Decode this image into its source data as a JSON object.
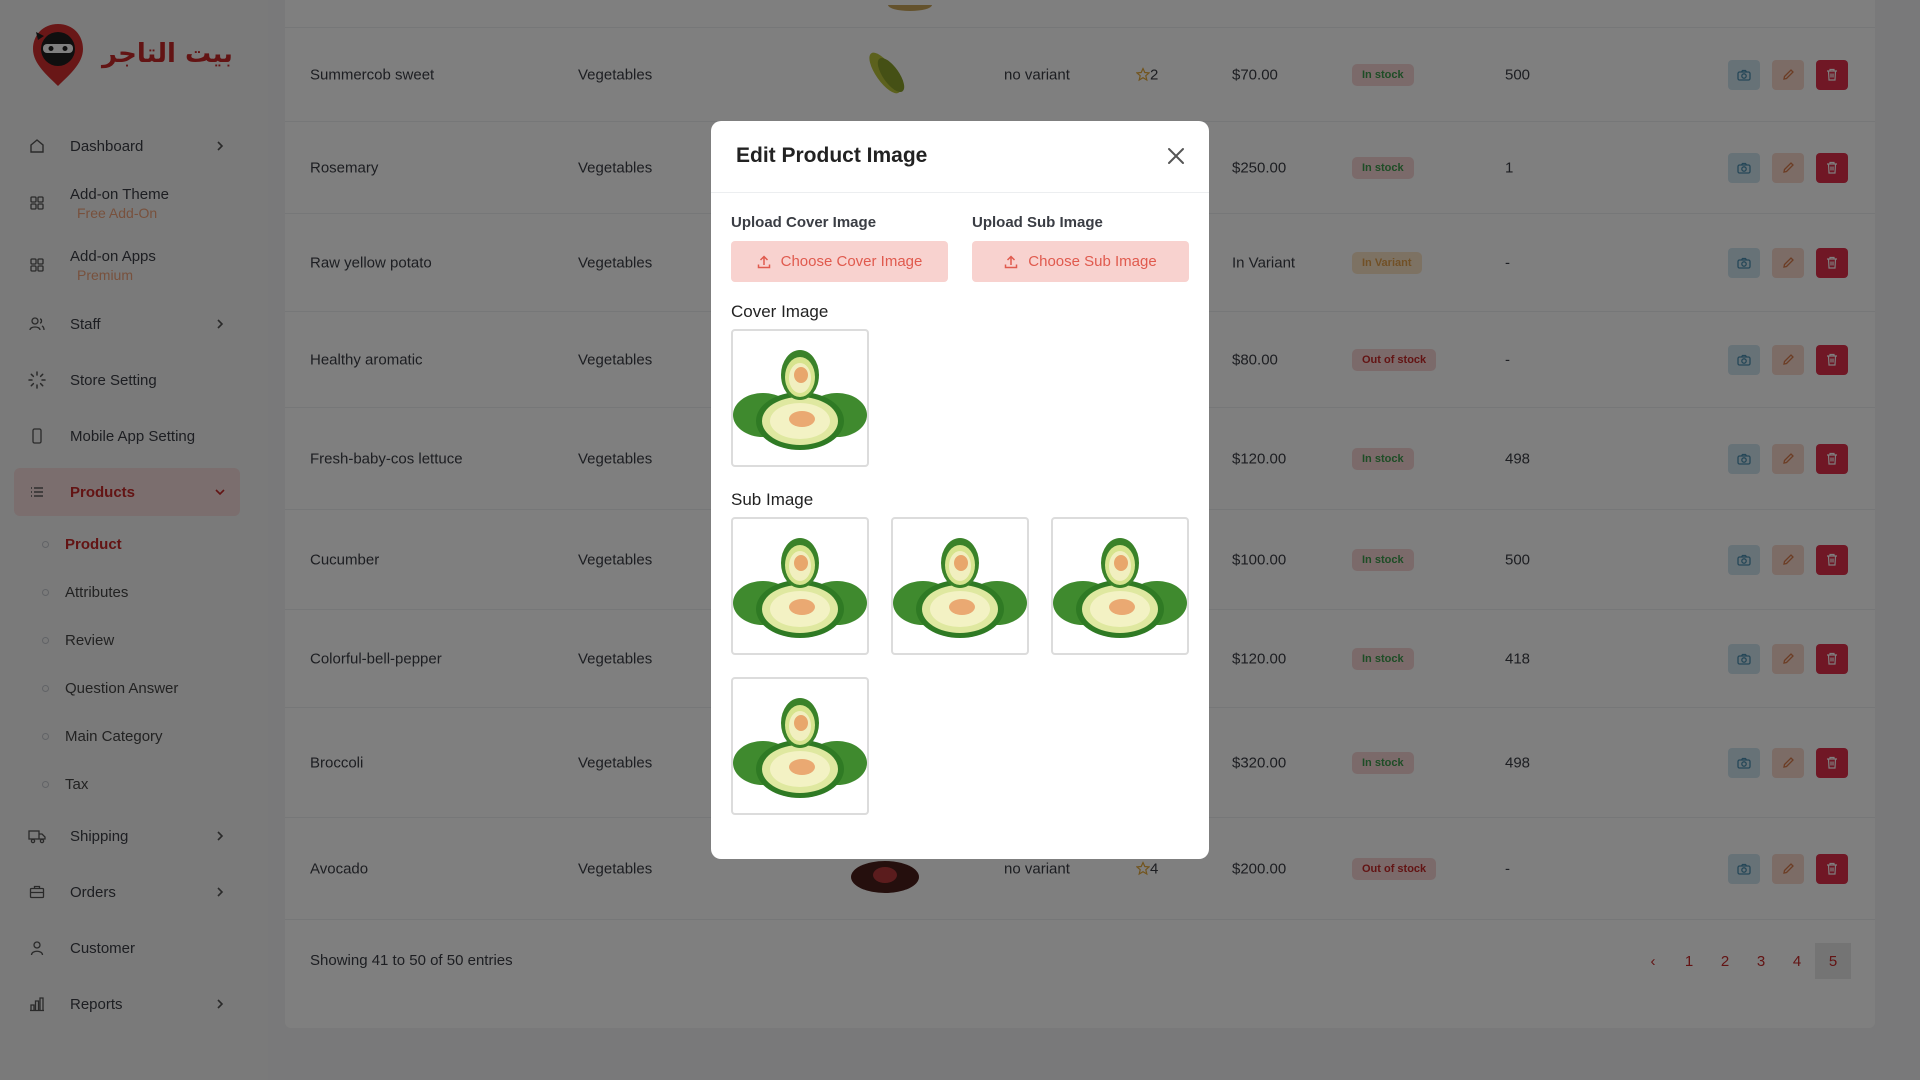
{
  "brand": {
    "name": "بيت التاجر"
  },
  "sidebar": {
    "items": [
      {
        "label": "Dashboard",
        "icon": "home-icon"
      },
      {
        "label": "Add-on Theme",
        "sub": "Free Add-On",
        "icon": "grid-icon"
      },
      {
        "label": "Add-on Apps",
        "sub": "Premium",
        "icon": "grid-icon"
      },
      {
        "label": "Staff",
        "icon": "users-icon"
      },
      {
        "label": "Store Setting",
        "icon": "loader-icon"
      },
      {
        "label": "Mobile App Setting",
        "icon": "mobile-icon"
      },
      {
        "label": "Products",
        "icon": "list-icon"
      },
      {
        "label": "Shipping",
        "icon": "truck-icon"
      },
      {
        "label": "Orders",
        "icon": "briefcase-icon"
      },
      {
        "label": "Customer",
        "icon": "user-icon"
      },
      {
        "label": "Reports",
        "icon": "bar-chart-icon"
      }
    ],
    "products_sub": [
      "Product",
      "Attributes",
      "Review",
      "Question Answer",
      "Main Category",
      "Tax"
    ]
  },
  "table": {
    "rows": [
      {
        "name": "Summercob sweet",
        "category": "Vegetables",
        "variant": "no variant",
        "rating": "2",
        "price": "$70.00",
        "stock_label": "In stock",
        "stock_type": "in",
        "qty": "500"
      },
      {
        "name": "Rosemary",
        "category": "Vegetables",
        "variant": "",
        "rating": "",
        "price": "$250.00",
        "stock_label": "In stock",
        "stock_type": "in",
        "qty": "1"
      },
      {
        "name": "Raw yellow potato",
        "category": "Vegetables",
        "variant": "",
        "rating": "",
        "price": "In Variant",
        "stock_label": "In Variant",
        "stock_type": "var",
        "qty": "-"
      },
      {
        "name": "Healthy aromatic",
        "category": "Vegetables",
        "variant": "",
        "rating": "",
        "price": "$80.00",
        "stock_label": "Out of stock",
        "stock_type": "out",
        "qty": "-"
      },
      {
        "name": "Fresh-baby-cos lettuce",
        "category": "Vegetables",
        "variant": "",
        "rating": "",
        "price": "$120.00",
        "stock_label": "In stock",
        "stock_type": "in",
        "qty": "498"
      },
      {
        "name": "Cucumber",
        "category": "Vegetables",
        "variant": "",
        "rating": "",
        "price": "$100.00",
        "stock_label": "In stock",
        "stock_type": "in",
        "qty": "500"
      },
      {
        "name": "Colorful-bell-pepper",
        "category": "Vegetables",
        "variant": "",
        "rating": "",
        "price": "$120.00",
        "stock_label": "In stock",
        "stock_type": "in",
        "qty": "418"
      },
      {
        "name": "Broccoli",
        "category": "Vegetables",
        "variant": "",
        "rating": "",
        "price": "$320.00",
        "stock_label": "In stock",
        "stock_type": "in",
        "qty": "498"
      },
      {
        "name": "Avocado",
        "category": "Vegetables",
        "variant": "no variant",
        "rating": "4",
        "price": "$200.00",
        "stock_label": "Out of stock",
        "stock_type": "out",
        "qty": "-"
      }
    ],
    "footer": "Showing 41 to 50 of 50 entries",
    "pages": [
      "1",
      "2",
      "3",
      "4",
      "5"
    ],
    "prev": "‹"
  },
  "modal": {
    "title": "Edit Product Image",
    "cover_label": "Upload Cover Image",
    "cover_btn": "Choose Cover Image",
    "sub_label": "Upload Sub Image",
    "sub_btn": "Choose Sub Image",
    "cover_heading": "Cover Image",
    "sub_heading": "Sub Image"
  },
  "colors": {
    "accent": "#c62828",
    "in_stock": "#3d9a4c",
    "button_bg": "#f8d2cf"
  }
}
